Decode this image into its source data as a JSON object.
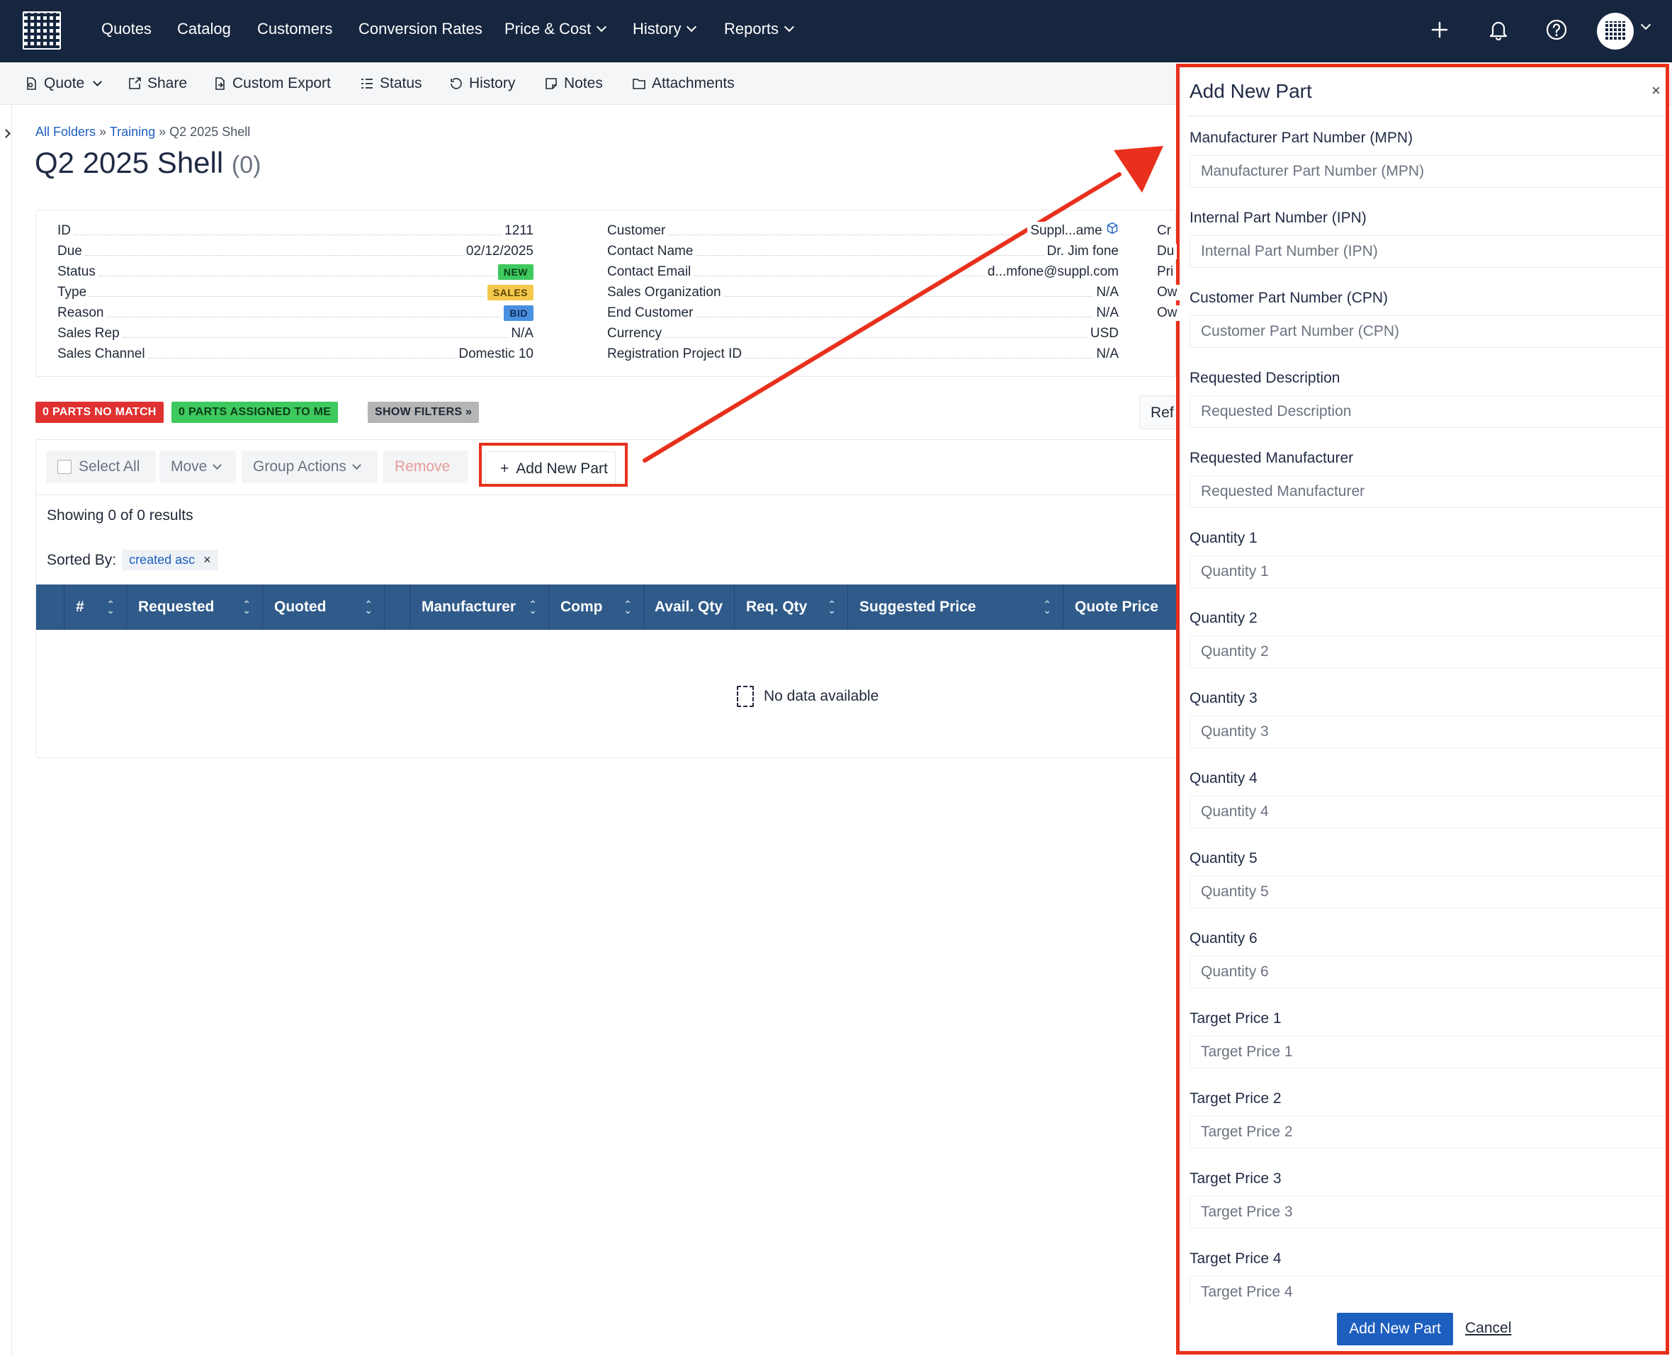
{
  "nav": {
    "items": [
      "Quotes",
      "Catalog",
      "Customers",
      "Conversion Rates",
      "Price & Cost",
      "History",
      "Reports"
    ]
  },
  "toolbar": {
    "quote": "Quote",
    "share": "Share",
    "custom_export": "Custom Export",
    "status": "Status",
    "history": "History",
    "notes": "Notes",
    "attachments": "Attachments"
  },
  "breadcrumb": {
    "all_folders": "All Folders",
    "sep": "»",
    "training": "Training",
    "current": "Q2 2025 Shell"
  },
  "page": {
    "title": "Q2 2025 Shell",
    "count": "(0)"
  },
  "info": {
    "left": [
      {
        "label": "ID",
        "value": "1211"
      },
      {
        "label": "Due",
        "value": "02/12/2025"
      },
      {
        "label": "Status",
        "value": "NEW"
      },
      {
        "label": "Type",
        "value": "SALES"
      },
      {
        "label": "Reason",
        "value": "BID"
      },
      {
        "label": "Sales Rep",
        "value": "N/A"
      },
      {
        "label": "Sales Channel",
        "value": "Domestic 10"
      }
    ],
    "middle": [
      {
        "label": "Customer",
        "value": "Suppl...ame"
      },
      {
        "label": "Contact Name",
        "value": "Dr. Jim fone"
      },
      {
        "label": "Contact Email",
        "value": "d...mfone@suppl.com"
      },
      {
        "label": "Sales Organization",
        "value": "N/A"
      },
      {
        "label": "End Customer",
        "value": "N/A"
      },
      {
        "label": "Currency",
        "value": "USD"
      },
      {
        "label": "Registration Project ID",
        "value": "N/A"
      }
    ],
    "right_partial": [
      "Cr",
      "Du",
      "Pri",
      "Ow",
      "Ow"
    ]
  },
  "filters": {
    "no_match": "0 PARTS NO MATCH",
    "assigned": "0 PARTS ASSIGNED TO ME",
    "show_filters": "SHOW FILTERS »",
    "refresh_partial": "Ref"
  },
  "actions": {
    "select_all": "Select All",
    "move": "Move",
    "group_actions": "Group Actions",
    "remove": "Remove",
    "add_new_part": "Add New Part"
  },
  "results": {
    "showing": "Showing 0 of 0 results",
    "sorted_by": "Sorted By:",
    "sort_tag": "created asc"
  },
  "table": {
    "columns": [
      "#",
      "Requested",
      "Quoted",
      "",
      "Manufacturer",
      "Comp",
      "Avail. Qty",
      "Req. Qty",
      "Suggested Price",
      "Quote Price"
    ],
    "empty": "No data available"
  },
  "drawer": {
    "title": "Add New Part",
    "close": "×",
    "fields": [
      {
        "label": "Manufacturer Part Number (MPN)",
        "placeholder": "Manufacturer Part Number (MPN)"
      },
      {
        "label": "Internal Part Number (IPN)",
        "placeholder": "Internal Part Number (IPN)"
      },
      {
        "label": "Customer Part Number (CPN)",
        "placeholder": "Customer Part Number (CPN)"
      },
      {
        "label": "Requested Description",
        "placeholder": "Requested Description"
      },
      {
        "label": "Requested Manufacturer",
        "placeholder": "Requested Manufacturer"
      },
      {
        "label": "Quantity 1",
        "placeholder": "Quantity 1"
      },
      {
        "label": "Quantity 2",
        "placeholder": "Quantity 2"
      },
      {
        "label": "Quantity 3",
        "placeholder": "Quantity 3"
      },
      {
        "label": "Quantity 4",
        "placeholder": "Quantity 4"
      },
      {
        "label": "Quantity 5",
        "placeholder": "Quantity 5"
      },
      {
        "label": "Quantity 6",
        "placeholder": "Quantity 6"
      },
      {
        "label": "Target Price 1",
        "placeholder": "Target Price 1"
      },
      {
        "label": "Target Price 2",
        "placeholder": "Target Price 2"
      },
      {
        "label": "Target Price 3",
        "placeholder": "Target Price 3"
      },
      {
        "label": "Target Price 4",
        "placeholder": "Target Price 4"
      }
    ],
    "submit": "Add New Part",
    "cancel": "Cancel"
  },
  "colors": {
    "nav_bg": "#17263f",
    "table_header": "#2f5a8a",
    "primary": "#1d5fbf",
    "annotation": "#e8301c",
    "badge_new": "#3ec95e",
    "badge_sales": "#f2c94c",
    "badge_bid": "#4a90e2",
    "chip_red": "#e03131"
  },
  "icons": [
    "app-logo-icon",
    "plus-icon",
    "bell-icon",
    "help-icon",
    "avatar-icon",
    "quote-icon",
    "share-icon",
    "export-icon",
    "status-icon",
    "history-icon",
    "notes-icon",
    "folder-icon",
    "cube-icon",
    "empty-file-icon",
    "annotation-arrow"
  ]
}
